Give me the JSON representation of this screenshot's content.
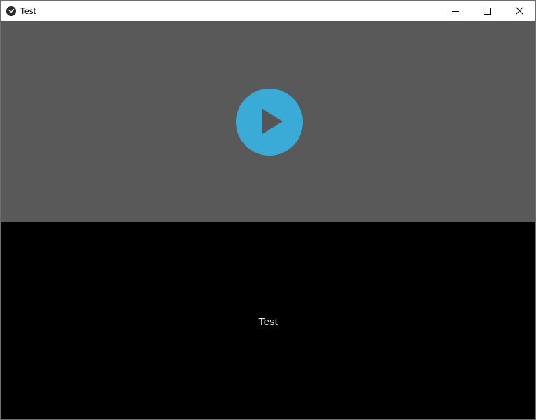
{
  "window": {
    "title": "Test",
    "app_icon": "kivy-icon",
    "controls": {
      "minimize_icon": "minimize-icon",
      "maximize_icon": "maximize-icon",
      "close_icon": "close-icon"
    }
  },
  "video": {
    "play_icon": "play-icon",
    "background_color": "#595959",
    "accent_color": "#3aabd6"
  },
  "content": {
    "label": "Test"
  }
}
